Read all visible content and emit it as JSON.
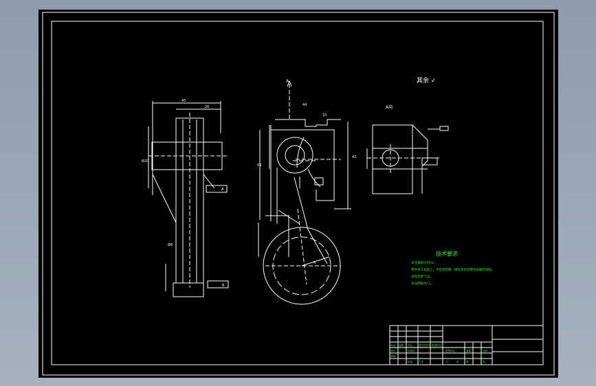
{
  "drawing": {
    "section_label": "A",
    "view_label": "A向",
    "roughness_note": "其余 ✓",
    "dims_left": [
      "45",
      "20",
      "Φ20",
      "Φ8"
    ],
    "dims_center": [
      "44",
      "10",
      "54",
      "42",
      "R"
    ],
    "datum_labels": [
      "A",
      "B"
    ],
    "tech_title": "技术要求",
    "tech_lines": [
      "未注圆角均为R2。",
      "零件加工表面上，不应有划痕、擦伤等损伤零件表面的缺陷。",
      "去除毛刺飞边。",
      "未注倒角为C1。"
    ],
    "title_block": {
      "cells": [
        "标记",
        "处数",
        "分区",
        "更改文件号",
        "签名",
        "年月日",
        "设计",
        "标准化",
        "阶段标记",
        "重量",
        "比例",
        "审核",
        "工艺",
        "批准",
        "共",
        "张",
        "第",
        "张"
      ]
    }
  },
  "colors": {
    "background": "#000000",
    "lines": "#ffffff",
    "annotations": "#00ff00",
    "page": "#9aa7b7"
  }
}
